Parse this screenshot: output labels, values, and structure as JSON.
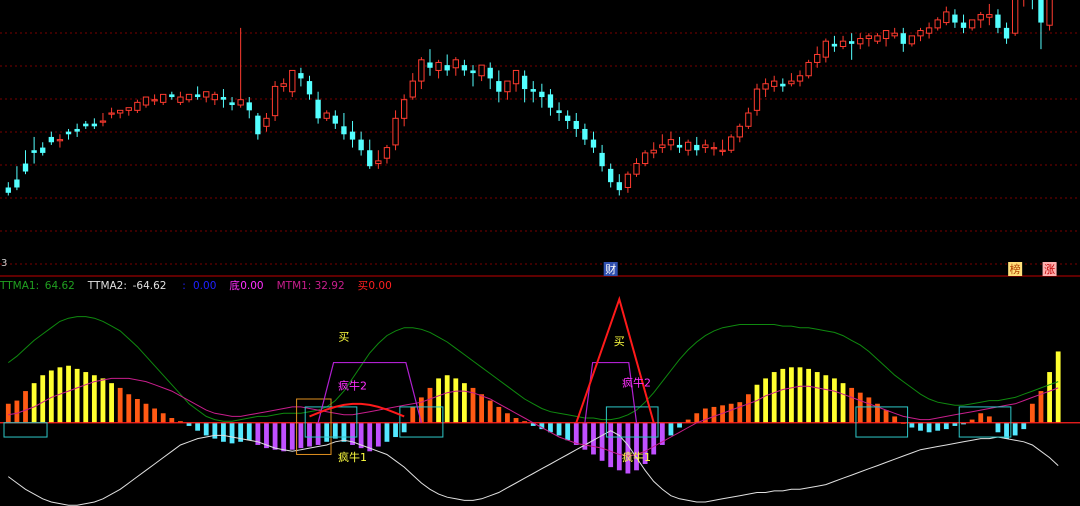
{
  "colors": {
    "background": "#000000",
    "up": "#ff3b2f",
    "down": "#54ffff",
    "grid": "#7a0000",
    "divider": "#c00000",
    "ttma_upper": "#0f8a0f",
    "ttma_lower": "#e0e0e0",
    "mtm_line": "#c81e8c",
    "zero_line": "#ff2020",
    "hist_orange": "#ff5a14",
    "hist_yellow": "#ffff30",
    "hist_cyan": "#54e8ff",
    "hist_violet": "#c050ff",
    "box_cyan": "#2ec8c8",
    "box_orange": "#e09020",
    "arc_violet": "#b020d0",
    "signal_red": "#ff1a1a",
    "label_yellow": "#ffff40",
    "label_magenta": "#ff30ff"
  },
  "price_panel": {
    "left_edge_label": "3",
    "top_right_label": "—",
    "event_tags": [
      {
        "text": "财",
        "bg": "#3050b0",
        "fg": "#ffffff",
        "x_index": 70
      },
      {
        "text": "榜",
        "bg": "#ffe07a",
        "fg": "#b04000",
        "x_index": 117
      },
      {
        "text": "涨",
        "bg": "#ffb0b0",
        "fg": "#c00000",
        "x_index": 121
      }
    ]
  },
  "indicator_header": [
    {
      "label": "TTMA1:",
      "value": "64.62",
      "color": "#20a020"
    },
    {
      "label": "TTMA2:",
      "value": "-64.62",
      "color": "#e0e0e0"
    },
    {
      "label": ":",
      "value": "0.00",
      "color": "#2020ff"
    },
    {
      "label": "底",
      "value": "0.00",
      "color": "#ff30ff"
    },
    {
      "label": "MTM1:",
      "value": "32.92",
      "color": "#c81e8c"
    },
    {
      "label": "买",
      "value": "0.00",
      "color": "#ff2020"
    }
  ],
  "annotations": [
    {
      "text": "买",
      "color": "#ffff40",
      "x_index": 39,
      "y_level": 52
    },
    {
      "text": "疯牛2",
      "color": "#ff30ff",
      "x_index": 40,
      "y_level": 21
    },
    {
      "text": "疯牛1",
      "color": "#ffff40",
      "x_index": 40,
      "y_level": -24
    },
    {
      "text": "买",
      "color": "#ffff40",
      "x_index": 71,
      "y_level": 49
    },
    {
      "text": "疯牛2",
      "color": "#ff30ff",
      "x_index": 73,
      "y_level": 23
    },
    {
      "text": "疯牛1",
      "color": "#ffff40",
      "x_index": 73,
      "y_level": -24
    }
  ],
  "chart_data": {
    "type": "candlestick+histogram",
    "price": {
      "ylim": [
        0,
        100
      ],
      "ohlc": [
        [
          22,
          24,
          20,
          19
        ],
        [
          25,
          30,
          22,
          21
        ],
        [
          31,
          36,
          28,
          27
        ],
        [
          36,
          41,
          35,
          31
        ],
        [
          37,
          39,
          35,
          34
        ],
        [
          41,
          43,
          39,
          38
        ],
        [
          40,
          42,
          40,
          37
        ],
        [
          43,
          44,
          42,
          40
        ],
        [
          44,
          46,
          43,
          41
        ],
        [
          46,
          47,
          45,
          44
        ],
        [
          46,
          48,
          45,
          44
        ],
        [
          47,
          50,
          47,
          45
        ],
        [
          50,
          52,
          50,
          48
        ],
        [
          50,
          51,
          51,
          48
        ],
        [
          51,
          52,
          52,
          49
        ],
        [
          51,
          55,
          54,
          50
        ],
        [
          53,
          55,
          56,
          52
        ],
        [
          55,
          57,
          55,
          53
        ],
        [
          54,
          56,
          57,
          53
        ],
        [
          57,
          58,
          56,
          55
        ],
        [
          54,
          58,
          56,
          53
        ],
        [
          55,
          57,
          57,
          54
        ],
        [
          57,
          60,
          56,
          55
        ],
        [
          56,
          58,
          58,
          54
        ],
        [
          55,
          58,
          57,
          53
        ],
        [
          56,
          59,
          55,
          52
        ],
        [
          54,
          56,
          53,
          51
        ],
        [
          53,
          82,
          55,
          52
        ],
        [
          54,
          56,
          51,
          48
        ],
        [
          49,
          50,
          42,
          40
        ],
        [
          45,
          50,
          48,
          43
        ],
        [
          49,
          62,
          60,
          47
        ],
        [
          60,
          63,
          61,
          58
        ],
        [
          58,
          63,
          66,
          56
        ],
        [
          65,
          67,
          63,
          60
        ],
        [
          62,
          64,
          57,
          55
        ],
        [
          55,
          58,
          48,
          46
        ],
        [
          48,
          51,
          50,
          47
        ],
        [
          49,
          51,
          46,
          44
        ],
        [
          45,
          50,
          42,
          40
        ],
        [
          43,
          47,
          40,
          37
        ],
        [
          40,
          43,
          36,
          34
        ],
        [
          36,
          40,
          30,
          29
        ],
        [
          31,
          36,
          32,
          29
        ],
        [
          33,
          38,
          37,
          31
        ],
        [
          38,
          51,
          48,
          36
        ],
        [
          48,
          57,
          55,
          45
        ],
        [
          56,
          65,
          62,
          55
        ],
        [
          62,
          71,
          70,
          59
        ],
        [
          69,
          74,
          67,
          64
        ],
        [
          66,
          70,
          69,
          63
        ],
        [
          68,
          72,
          66,
          64
        ],
        [
          67,
          71,
          70,
          64
        ],
        [
          68,
          70,
          66,
          64
        ],
        [
          66,
          68,
          65,
          60
        ],
        [
          64,
          67,
          68,
          62
        ],
        [
          67,
          69,
          63,
          59
        ],
        [
          62,
          66,
          58,
          54
        ],
        [
          58,
          61,
          62,
          55
        ],
        [
          61,
          65,
          66,
          58
        ],
        [
          64,
          66,
          59,
          54
        ],
        [
          59,
          62,
          58,
          54
        ],
        [
          58,
          61,
          56,
          52
        ],
        [
          57,
          59,
          52,
          49
        ],
        [
          51,
          54,
          50,
          47
        ],
        [
          49,
          51,
          47,
          44
        ],
        [
          47,
          50,
          44,
          41
        ],
        [
          44,
          46,
          40,
          38
        ],
        [
          40,
          43,
          37,
          35
        ],
        [
          35,
          38,
          30,
          28
        ],
        [
          29,
          31,
          24,
          22
        ],
        [
          24,
          27,
          21,
          19
        ],
        [
          22,
          28,
          27,
          20
        ],
        [
          27,
          33,
          31,
          26
        ],
        [
          31,
          36,
          35,
          30
        ],
        [
          35,
          39,
          36,
          33
        ],
        [
          37,
          42,
          38,
          35
        ],
        [
          38,
          43,
          40,
          36
        ],
        [
          38,
          41,
          37,
          35
        ],
        [
          36,
          40,
          39,
          34
        ],
        [
          38,
          41,
          36,
          34
        ],
        [
          37,
          40,
          38,
          35
        ],
        [
          37,
          39,
          37,
          34
        ],
        [
          36,
          40,
          36,
          34
        ],
        [
          36,
          42,
          41,
          35
        ],
        [
          41,
          46,
          45,
          39
        ],
        [
          45,
          52,
          50,
          44
        ],
        [
          51,
          61,
          59,
          49
        ],
        [
          59,
          63,
          61,
          56
        ],
        [
          60,
          64,
          62,
          58
        ],
        [
          61,
          63,
          60,
          58
        ],
        [
          61,
          65,
          62,
          60
        ],
        [
          62,
          66,
          64,
          60
        ],
        [
          64,
          70,
          69,
          63
        ],
        [
          69,
          75,
          72,
          67
        ],
        [
          71,
          78,
          77,
          69
        ],
        [
          76,
          79,
          75,
          73
        ],
        [
          75,
          79,
          77,
          74
        ],
        [
          77,
          80,
          76,
          70
        ],
        [
          76,
          80,
          78,
          74
        ],
        [
          78,
          80,
          79,
          75
        ],
        [
          77,
          80,
          79,
          76
        ],
        [
          78,
          80,
          81,
          75
        ],
        [
          79,
          82,
          80,
          78
        ],
        [
          80,
          82,
          76,
          73
        ],
        [
          76,
          79,
          79,
          75
        ],
        [
          79,
          82,
          81,
          77
        ],
        [
          80,
          84,
          82,
          78
        ],
        [
          82,
          86,
          85,
          81
        ],
        [
          84,
          90,
          88,
          83
        ],
        [
          87,
          89,
          84,
          82
        ],
        [
          84,
          87,
          82,
          80
        ],
        [
          82,
          85,
          85,
          81
        ],
        [
          85,
          88,
          87,
          82
        ],
        [
          86,
          91,
          87,
          83
        ],
        [
          87,
          89,
          82,
          80
        ],
        [
          82,
          84,
          78,
          76
        ],
        [
          80,
          98,
          95,
          79
        ],
        [
          95,
          102,
          107,
          90
        ],
        [
          106,
          108,
          94,
          89
        ],
        [
          93,
          96,
          84,
          74
        ],
        [
          83,
          97,
          100,
          81
        ],
        [
          98,
          110,
          108,
          94
        ],
        [
          105,
          115,
          116,
          103
        ],
        [
          114,
          126,
          122,
          112
        ]
      ]
    },
    "indicator": {
      "ylim": [
        -50,
        80
      ],
      "histogram": [
        12,
        14,
        20,
        25,
        30,
        33,
        35,
        36,
        34,
        32,
        30,
        28,
        25,
        22,
        18,
        15,
        12,
        9,
        6,
        3,
        1,
        -2,
        -5,
        -8,
        -10,
        -12,
        -13,
        -12,
        -11,
        -14,
        -16,
        -17,
        -18,
        -17,
        -16,
        -15,
        -14,
        -12,
        -10,
        -12,
        -14,
        -16,
        -18,
        -15,
        -12,
        -9,
        -6,
        10,
        16,
        22,
        28,
        30,
        28,
        25,
        22,
        18,
        14,
        10,
        6,
        3,
        1,
        -2,
        -4,
        -6,
        -8,
        -11,
        -14,
        -17,
        -20,
        -24,
        -28,
        -30,
        -32,
        -30,
        -26,
        -20,
        -14,
        -8,
        -3,
        2,
        6,
        9,
        10,
        11,
        12,
        13,
        18,
        24,
        28,
        32,
        34,
        35,
        35,
        34,
        32,
        30,
        28,
        25,
        22,
        19,
        16,
        12,
        8,
        4,
        0,
        -3,
        -5,
        -6,
        -5,
        -4,
        -2,
        -1,
        2,
        6,
        4,
        -6,
        -10,
        -8,
        -4,
        12,
        20,
        32,
        45
      ],
      "ttma1": [
        38,
        42,
        47,
        52,
        56,
        60,
        64,
        66,
        67,
        67,
        66,
        64,
        61,
        58,
        53,
        48,
        42,
        36,
        30,
        24,
        18,
        12,
        8,
        4,
        2,
        1,
        1,
        2,
        3,
        4,
        4,
        5,
        6,
        6,
        6,
        7,
        8,
        10,
        14,
        20,
        28,
        36,
        44,
        50,
        55,
        58,
        60,
        60,
        59,
        57,
        54,
        51,
        47,
        43,
        39,
        35,
        31,
        27,
        23,
        19,
        15,
        12,
        9,
        7,
        6,
        5,
        4,
        3,
        3,
        2,
        2,
        3,
        5,
        8,
        13,
        19,
        26,
        33,
        40,
        46,
        51,
        55,
        58,
        60,
        61,
        62,
        62,
        62,
        62,
        62,
        61,
        61,
        60,
        60,
        59,
        58,
        57,
        55,
        52,
        49,
        45,
        40,
        35,
        30,
        26,
        22,
        18,
        15,
        13,
        12,
        11,
        11,
        12,
        13,
        14,
        14,
        15,
        16,
        18,
        20,
        22,
        24,
        26
      ],
      "ttma2": [
        -34,
        -38,
        -42,
        -45,
        -48,
        -50,
        -51,
        -52,
        -52,
        -51,
        -50,
        -48,
        -45,
        -42,
        -38,
        -34,
        -30,
        -26,
        -22,
        -18,
        -14,
        -12,
        -10,
        -9,
        -8,
        -8,
        -9,
        -10,
        -11,
        -12,
        -14,
        -16,
        -17,
        -18,
        -17,
        -16,
        -15,
        -14,
        -12,
        -11,
        -12,
        -14,
        -16,
        -18,
        -20,
        -24,
        -28,
        -33,
        -38,
        -42,
        -45,
        -47,
        -48,
        -49,
        -49,
        -48,
        -46,
        -44,
        -41,
        -38,
        -35,
        -32,
        -29,
        -26,
        -23,
        -20,
        -17,
        -14,
        -11,
        -8,
        -5,
        -8,
        -14,
        -22,
        -30,
        -37,
        -42,
        -46,
        -48,
        -49,
        -50,
        -50,
        -49,
        -48,
        -47,
        -46,
        -45,
        -44,
        -44,
        -43,
        -43,
        -42,
        -42,
        -41,
        -40,
        -39,
        -37,
        -35,
        -33,
        -31,
        -29,
        -27,
        -25,
        -23,
        -21,
        -19,
        -17,
        -16,
        -15,
        -14,
        -13,
        -12,
        -11,
        -10,
        -10,
        -9,
        -10,
        -11,
        -12,
        -14,
        -18,
        -22,
        -27
      ],
      "mtm1": [
        5,
        6,
        8,
        10,
        13,
        16,
        18,
        20,
        22,
        24,
        26,
        27,
        28,
        28,
        28,
        27,
        26,
        24,
        22,
        20,
        17,
        14,
        11,
        8,
        6,
        5,
        4,
        4,
        5,
        6,
        7,
        8,
        9,
        10,
        10,
        9,
        8,
        7,
        6,
        5,
        5,
        6,
        7,
        8,
        9,
        10,
        11,
        12,
        13,
        15,
        17,
        19,
        20,
        20,
        19,
        17,
        15,
        12,
        9,
        6,
        3,
        0,
        -3,
        -6,
        -9,
        -11,
        -13,
        -14,
        -15,
        -16,
        -18,
        -20,
        -21,
        -20,
        -18,
        -15,
        -12,
        -9,
        -6,
        -3,
        0,
        2,
        4,
        6,
        8,
        10,
        12,
        14,
        17,
        19,
        21,
        22,
        23,
        23,
        22,
        21,
        20,
        18,
        16,
        14,
        12,
        10,
        8,
        6,
        4,
        3,
        2,
        2,
        3,
        4,
        5,
        6,
        7,
        8,
        9,
        10,
        11,
        12,
        14,
        16,
        18,
        20,
        22
      ],
      "signal": {
        "x_start": 66,
        "x_end": 75,
        "peak_index": 71,
        "peak_value": 78,
        "flat_segments": [
          [
            35,
            46,
            4
          ]
        ]
      },
      "boxes": [
        {
          "x0": 0,
          "x1": 4,
          "y0": -9,
          "y1": 0,
          "color": "#2ec8c8"
        },
        {
          "x0": 34,
          "x1": 37,
          "y0": -20,
          "y1": 15,
          "color": "#e09020"
        },
        {
          "x0": 35,
          "x1": 40,
          "y0": -9,
          "y1": 10,
          "color": "#2ec8c8"
        },
        {
          "x0": 46,
          "x1": 50,
          "y0": -9,
          "y1": 10,
          "color": "#2ec8c8"
        },
        {
          "x0": 70,
          "x1": 75,
          "y0": -9,
          "y1": 10,
          "color": "#2ec8c8"
        },
        {
          "x0": 99,
          "x1": 104,
          "y0": -9,
          "y1": 10,
          "color": "#2ec8c8"
        },
        {
          "x0": 111,
          "x1": 116,
          "y0": -9,
          "y1": 10,
          "color": "#2ec8c8"
        }
      ],
      "arcs": [
        {
          "x0": 36,
          "x1": 48,
          "top": 38,
          "color": "#b020d0"
        },
        {
          "x0": 67,
          "x1": 73,
          "top": 38,
          "color": "#b020d0"
        }
      ]
    }
  }
}
